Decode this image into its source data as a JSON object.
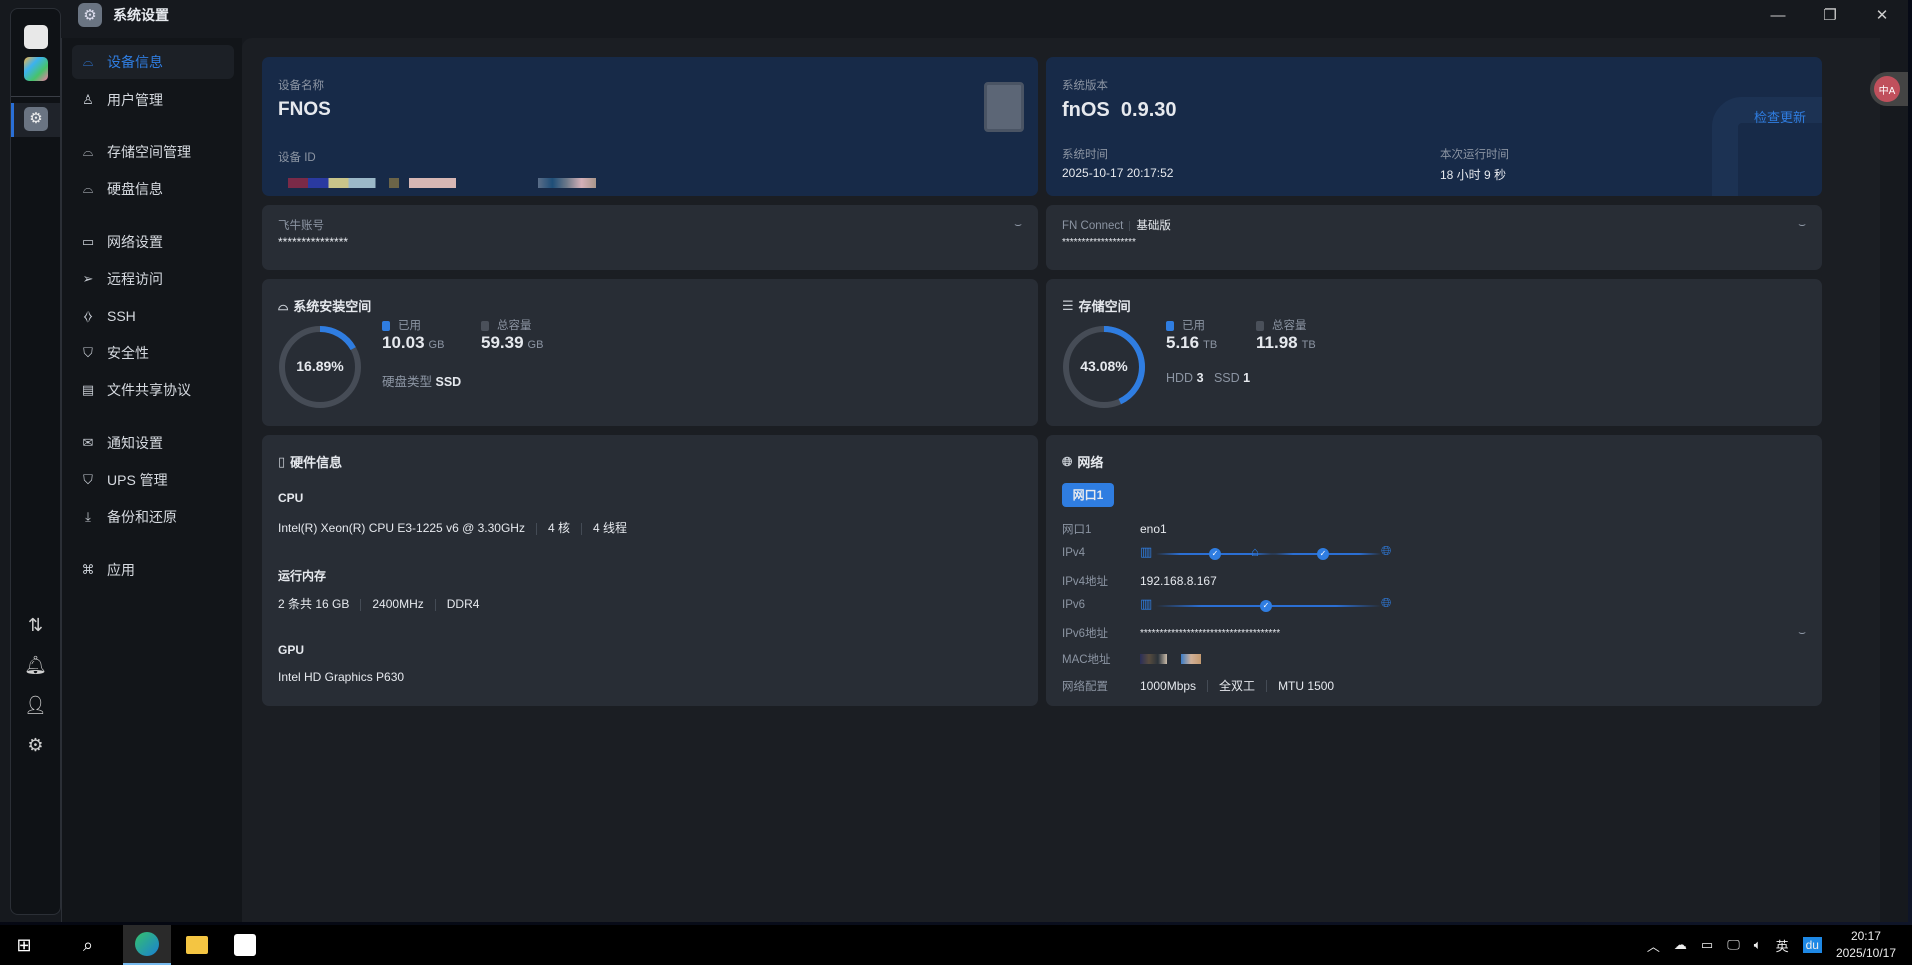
{
  "window": {
    "title": "系统设置",
    "controls": [
      "minimize",
      "restore",
      "close"
    ]
  },
  "nav": [
    {
      "label": "设备信息",
      "icon": "drive-icon",
      "active": true
    },
    {
      "label": "用户管理",
      "icon": "users-icon"
    },
    {
      "label": "存储空间管理",
      "icon": "storage-icon"
    },
    {
      "label": "硬盘信息",
      "icon": "disk-icon"
    },
    {
      "label": "网络设置",
      "icon": "network-icon"
    },
    {
      "label": "远程访问",
      "icon": "send-icon"
    },
    {
      "label": "SSH",
      "icon": "code-icon"
    },
    {
      "label": "安全性",
      "icon": "shield-check-icon"
    },
    {
      "label": "文件共享协议",
      "icon": "file-icon"
    },
    {
      "label": "通知设置",
      "icon": "mail-icon"
    },
    {
      "label": "UPS 管理",
      "icon": "shield-icon"
    },
    {
      "label": "备份和还原",
      "icon": "download-icon"
    },
    {
      "label": "应用",
      "icon": "apps-icon"
    }
  ],
  "device": {
    "name_label": "设备名称",
    "name": "FNOS",
    "id_label": "设备 ID"
  },
  "system": {
    "version_label": "系统版本",
    "os": "fnOS",
    "version": "0.9.30",
    "check_update": "检查更新",
    "time_label": "系统时间",
    "time": "2025-10-17 20:17:52",
    "uptime_label": "本次运行时间",
    "uptime": "18 小时 9 秒"
  },
  "account": {
    "label": "飞牛账号",
    "value": "***************"
  },
  "connect": {
    "label": "FN Connect",
    "tier": "基础版",
    "value": "*******************"
  },
  "sys_space": {
    "title": "系统安装空间",
    "percent": "16.89%",
    "percent_value": 16.89,
    "used_label": "已用",
    "used": "10.03",
    "used_unit": "GB",
    "total_label": "总容量",
    "total": "59.39",
    "total_unit": "GB",
    "type_label": "硬盘类型",
    "type": "SSD"
  },
  "storage": {
    "title": "存储空间",
    "percent": "43.08%",
    "percent_value": 43.08,
    "used_label": "已用",
    "used": "5.16",
    "used_unit": "TB",
    "total_label": "总容量",
    "total": "11.98",
    "total_unit": "TB",
    "hdd_label": "HDD",
    "hdd": "3",
    "ssd_label": "SSD",
    "ssd": "1"
  },
  "hardware": {
    "title": "硬件信息",
    "cpu_label": "CPU",
    "cpu_model": "Intel(R) Xeon(R) CPU E3-1225 v6 @ 3.30GHz",
    "cores": "4 核",
    "threads": "4 线程",
    "mem_label": "运行内存",
    "mem_size": "2 条共 16 GB",
    "mem_speed": "2400MHz",
    "mem_type": "DDR4",
    "gpu_label": "GPU",
    "gpu": "Intel HD Graphics P630"
  },
  "network": {
    "title": "网络",
    "tab": "网口1",
    "port_label": "网口1",
    "port": "eno1",
    "ipv4_label": "IPv4",
    "ipv4_addr_label": "IPv4地址",
    "ipv4_addr": "192.168.8.167",
    "ipv6_label": "IPv6",
    "ipv6_addr_label": "IPv6地址",
    "ipv6_addr": "************************************",
    "mac_label": "MAC地址",
    "config_label": "网络配置",
    "speed": "1000Mbps",
    "duplex": "全双工",
    "mtu": "MTU 1500"
  },
  "taskbar": {
    "ime": "英",
    "time": "20:17",
    "date": "2025/10/17",
    "baidu": "du"
  },
  "colors": {
    "accent": "#2f7de1",
    "card": "#282d35",
    "hero": "#172a48"
  }
}
